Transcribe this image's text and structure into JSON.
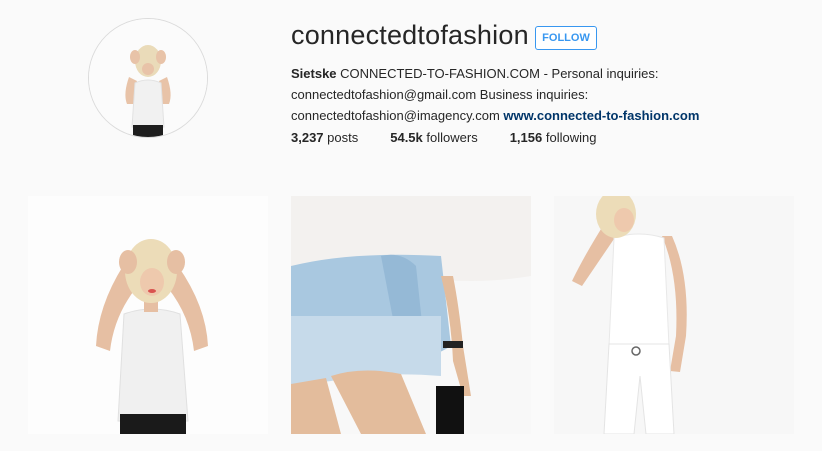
{
  "profile": {
    "username": "connectedtofashion",
    "follow_label": "FOLLOW",
    "bio_name": "Sietske",
    "bio_text": " CONNECTED-TO-FASHION.COM - Personal inquiries: connectedtofashion@gmail.com Business inquiries: connectedtofashion@imagency.com ",
    "website": "www.connected-to-fashion.com"
  },
  "stats": {
    "posts_count": "3,237",
    "posts_label": " posts",
    "followers_count": "54.5k",
    "followers_label": " followers",
    "following_count": "1,156",
    "following_label": " following"
  },
  "colors": {
    "accent": "#3897f0",
    "link": "#003569",
    "background": "#fafafa"
  },
  "icons": {
    "avatar": "profile-photo",
    "post1": "photo-woman-white-tee",
    "post2": "photo-denim-shorts",
    "post3": "photo-white-outfit"
  }
}
